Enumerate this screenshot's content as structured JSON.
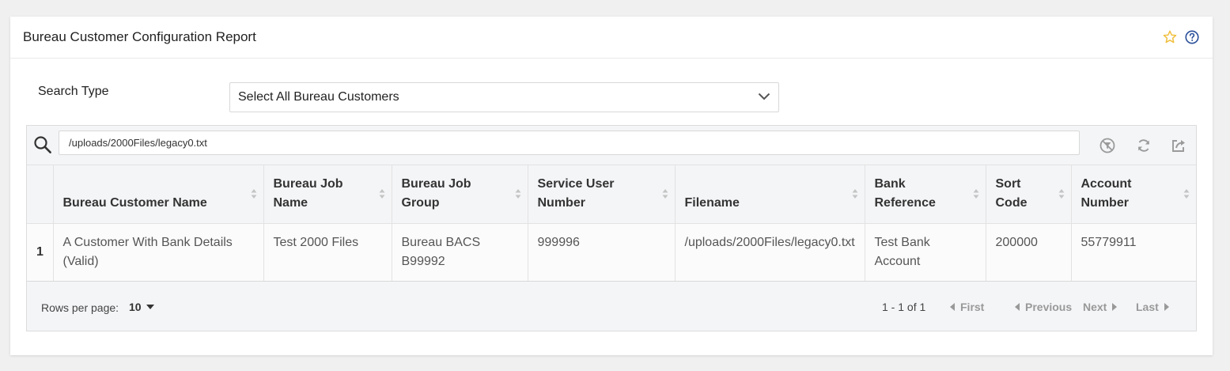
{
  "card": {
    "title": "Bureau Customer Configuration Report",
    "accent": "#f0c040",
    "help_color": "#2a4f9a"
  },
  "search_type": {
    "label": "Search Type",
    "selected": "Select All Bureau Customers"
  },
  "toolbar": {
    "search_value": "/uploads/2000Files/legacy0.txt",
    "icons": [
      "search-icon",
      "clear-filter-icon",
      "refresh-icon",
      "export-icon"
    ]
  },
  "table": {
    "columns": [
      "Bureau Customer Name",
      "Bureau Job Name",
      "Bureau Job Group",
      "Service User Number",
      "Filename",
      "Bank Reference",
      "Sort Code",
      "Account Number"
    ],
    "rows": [
      {
        "index": "1",
        "cells": [
          "A Customer With Bank Details (Valid)",
          "Test 2000 Files",
          "Bureau BACS B99992",
          "999996",
          "/uploads/2000Files/legacy0.txt",
          "Test Bank Account",
          "200000",
          "55779911"
        ]
      }
    ]
  },
  "footer": {
    "rows_per_page_label": "Rows per page:",
    "rows_per_page_value": "10",
    "range": "1 - 1 of 1",
    "first": "First",
    "previous": "Previous",
    "next": "Next",
    "last": "Last"
  }
}
